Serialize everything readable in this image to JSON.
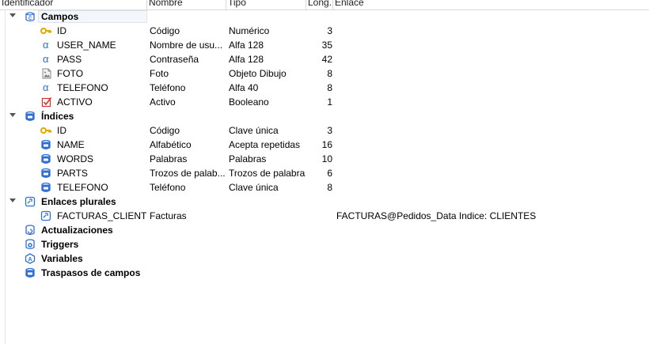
{
  "columns": {
    "identificador": "Identificador",
    "nombre": "Nombre",
    "tipo": "Tipo",
    "long": "Long.",
    "enlace": "Enlace"
  },
  "groups": {
    "campos": "Campos",
    "indices": "Índices",
    "enlaces_plurales": "Enlaces plurales",
    "actualizaciones": "Actualizaciones",
    "triggers": "Triggers",
    "variables": "Variables",
    "traspasos": "Traspasos de campos"
  },
  "campos": [
    {
      "id": "ID",
      "nombre": "Código",
      "tipo": "Numérico",
      "long": "3"
    },
    {
      "id": "USER_NAME",
      "nombre": "Nombre de usu...",
      "tipo": "Alfa 128",
      "long": "35"
    },
    {
      "id": "PASS",
      "nombre": "Contraseña",
      "tipo": "Alfa 128",
      "long": "42"
    },
    {
      "id": "FOTO",
      "nombre": "Foto",
      "tipo": "Objeto Dibujo",
      "long": "8"
    },
    {
      "id": "TELEFONO",
      "nombre": "Teléfono",
      "tipo": "Alfa 40",
      "long": "8"
    },
    {
      "id": "ACTIVO",
      "nombre": "Activo",
      "tipo": "Booleano",
      "long": "1"
    }
  ],
  "indices": [
    {
      "id": "ID",
      "nombre": "Código",
      "tipo": "Clave única",
      "long": "3"
    },
    {
      "id": "NAME",
      "nombre": "Alfabético",
      "tipo": "Acepta repetidas",
      "long": "16"
    },
    {
      "id": "WORDS",
      "nombre": "Palabras",
      "tipo": "Palabras",
      "long": "10"
    },
    {
      "id": "PARTS",
      "nombre": "Trozos de palab...",
      "tipo": "Trozos de palabras",
      "long": "6"
    },
    {
      "id": "TELEFONO",
      "nombre": "Teléfono",
      "tipo": "Clave única",
      "long": "8"
    }
  ],
  "enlaces": [
    {
      "id": "FACTURAS_CLIENTES",
      "nombre": "Facturas",
      "enlace": "FACTURAS@Pedidos_Data Indice: CLIENTES"
    }
  ],
  "colors": {
    "accent_blue": "#2e6fd1",
    "key_yellow": "#e0a800",
    "check_red": "#d9302e"
  }
}
